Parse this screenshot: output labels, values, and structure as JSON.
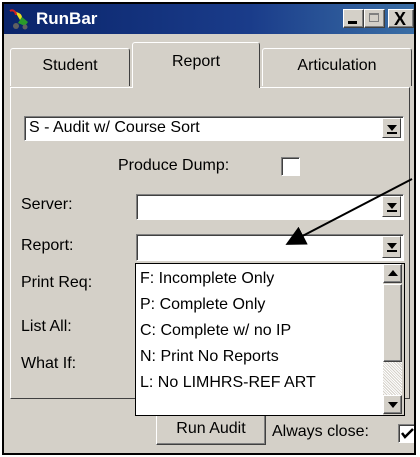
{
  "window": {
    "title": "RunBar"
  },
  "titlebar_buttons": {
    "minimize": "_",
    "maximize": "□",
    "close": "X"
  },
  "tabs": [
    {
      "label": "Student",
      "active": false
    },
    {
      "label": "Report",
      "active": true
    },
    {
      "label": "Articulation",
      "active": false
    }
  ],
  "report_type": {
    "value": "S - Audit w/ Course Sort"
  },
  "produce_dump": {
    "label": "Produce Dump:",
    "checked": false
  },
  "fields": {
    "server_label": "Server:",
    "report_label": "Report:",
    "print_req_label": "Print Req:",
    "list_all_label": "List All:",
    "what_if_label": "What If:"
  },
  "report_dropdown": {
    "options": [
      "F:  Incomplete Only",
      "P:  Complete Only",
      "C:  Complete w/ no IP",
      "N:  Print No Reports",
      "L:  No LIMHRS-REF ART"
    ]
  },
  "bottom": {
    "run_button": "Run Audit",
    "always_close_label": "Always close:",
    "always_close_checked": true
  },
  "colors": {
    "titlebar_start": "#0a246a",
    "titlebar_end": "#3a6ea5",
    "face": "#d4d0c8"
  }
}
